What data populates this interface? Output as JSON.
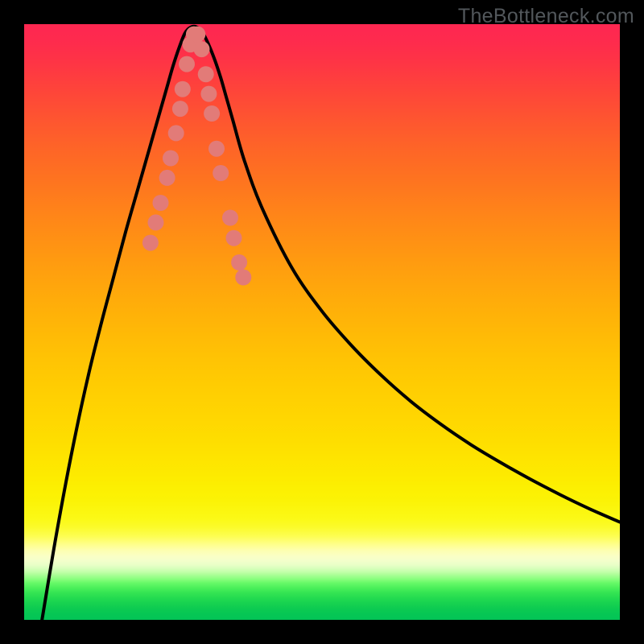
{
  "watermark": "TheBottleneck.com",
  "chart_data": {
    "type": "line",
    "title": "",
    "xlabel": "",
    "ylabel": "",
    "xlim": [
      0,
      100
    ],
    "ylim": [
      0,
      100
    ],
    "grid": false,
    "curve_note": "Black curve is inverted V: descends from top-left toward ~x=28 baseline, climbs toward right, ending near y=80 at x=100. y-direction: 0=top (bottleneck-high red), 100=bottom (green).",
    "curve": {
      "name": "bottleneck",
      "x": [
        3,
        5,
        7,
        9,
        11,
        13,
        15,
        17,
        19,
        20,
        21,
        22,
        23,
        24,
        25,
        26,
        27,
        28,
        29,
        30,
        31,
        32,
        33,
        34,
        35,
        37,
        40,
        45,
        50,
        55,
        60,
        65,
        70,
        75,
        80,
        85,
        90,
        95,
        100
      ],
      "y": [
        0,
        12,
        23,
        33,
        42,
        50,
        57.5,
        65,
        72,
        75.5,
        79,
        82.5,
        86,
        89.5,
        93,
        96,
        98.5,
        99.5,
        99.5,
        98.5,
        96.5,
        94,
        91,
        87.5,
        84,
        77,
        69,
        59,
        51.8,
        46,
        41,
        36.6,
        32.8,
        29.4,
        26.4,
        23.6,
        21,
        18.6,
        16.4
      ]
    },
    "markers": {
      "name": "marker-dots",
      "color": "#e27b78",
      "radius": 10,
      "x": [
        21.2,
        22.1,
        22.9,
        24.0,
        24.6,
        25.5,
        26.2,
        26.6,
        27.3,
        27.9,
        28.5,
        29.1,
        29.8,
        30.5,
        31.0,
        31.5,
        32.3,
        33.0,
        34.6,
        35.2,
        36.1,
        36.8
      ],
      "y": [
        63.3,
        66.7,
        70.0,
        74.2,
        77.5,
        81.7,
        85.8,
        89.1,
        93.3,
        96.6,
        98.3,
        98.3,
        95.8,
        91.6,
        88.3,
        85.0,
        79.1,
        75.0,
        67.5,
        64.1,
        60.0,
        57.5
      ]
    },
    "gradient_stops_note": "Background vertical gradient from red (top) through orange/yellow to green (bottom)"
  }
}
